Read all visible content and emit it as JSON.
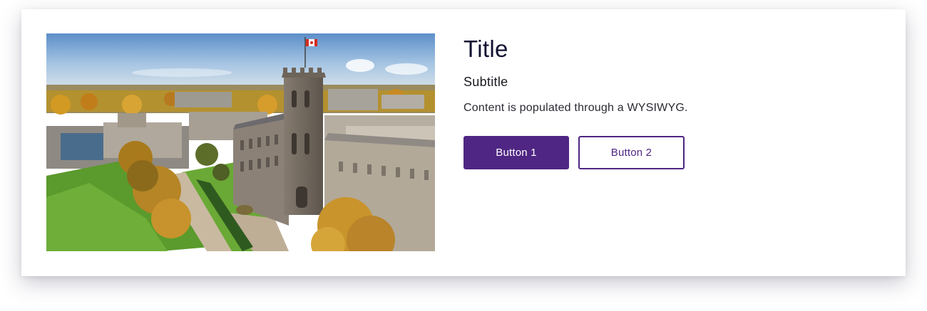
{
  "card": {
    "image_alt": "Aerial view of a university campus with a stone clock tower in autumn",
    "title": "Title",
    "subtitle": "Subtitle",
    "body": "Content is populated through a WYSIWYG.",
    "buttons": [
      {
        "label": "Button 1",
        "style": "primary"
      },
      {
        "label": "Button 2",
        "style": "secondary"
      }
    ]
  },
  "colors": {
    "brand_purple": "#4f2683",
    "title_text": "#121231",
    "body_text": "#2a2a33"
  }
}
